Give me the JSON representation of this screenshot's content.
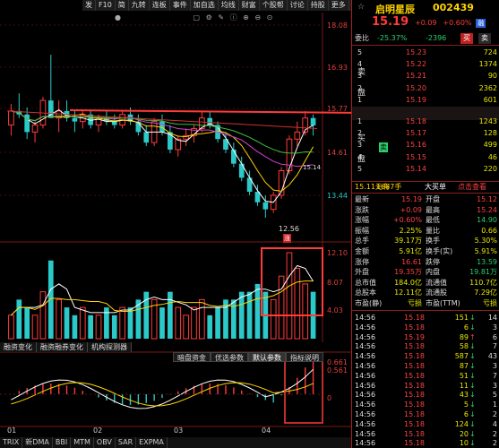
{
  "toolbar": {
    "items": [
      "发",
      "F10",
      "简",
      "九转",
      "连板",
      "事件",
      "加自选",
      "均线",
      "财富",
      "个股帮",
      "讨论",
      "持股",
      "更多"
    ]
  },
  "price_axis": [
    "18.08",
    "16.93",
    "15.77",
    "14.61",
    "13.44",
    "12.10",
    "8.07",
    "4.03"
  ],
  "annotations": {
    "low_price": "12.56",
    "low_tag": "涨",
    "last_marker": "15.14"
  },
  "chart_tabs": [
    "融资变化",
    "融资融券变化",
    "机构探测器"
  ],
  "indicator_tabs": [
    "暗盘资金",
    "优选参数",
    "默认参数",
    "指标说明"
  ],
  "indicator_axis": [
    "0.661",
    "0.561",
    "0"
  ],
  "dates": [
    "01",
    "02",
    "03",
    "04"
  ],
  "bottom_tabs": [
    "TRIX",
    "新DMA",
    "BBI",
    "MTM",
    "OBV",
    "SAR",
    "EXPMA"
  ],
  "quote": {
    "name": "启明星辰",
    "code": "002439",
    "last_price": "15.19",
    "change": "+0.09",
    "change_pct": "+0.60%",
    "badge": "融",
    "ratio_label": "委比",
    "ratio_pct": "-25.37%",
    "ratio_diff": "-2396",
    "buy_btn": "买",
    "sell_btn": "卖",
    "asks": [
      {
        "lvl": "5",
        "price": "15.23",
        "vol": "724"
      },
      {
        "lvl": "4",
        "price": "15.22",
        "vol": "1374"
      },
      {
        "lvl": "3",
        "price": "15.21",
        "vol": "90"
      },
      {
        "lvl": "2",
        "price": "15.20",
        "vol": "2362"
      },
      {
        "lvl": "1",
        "price": "15.19",
        "vol": "601"
      }
    ],
    "bids": [
      {
        "lvl": "1",
        "price": "15.18",
        "vol": "1243"
      },
      {
        "lvl": "2",
        "price": "15.17",
        "vol": "128"
      },
      {
        "lvl": "3",
        "price": "15.16",
        "vol": "499"
      },
      {
        "lvl": "4",
        "price": "15.15",
        "vol": "46"
      },
      {
        "lvl": "5",
        "price": "15.14",
        "vol": "220"
      }
    ],
    "ask_chars": [
      "卖",
      "盘"
    ],
    "bid_chars": [
      "买",
      "盘"
    ],
    "bid_tag": "卖",
    "bidask": {
      "a": "15.11元有",
      "b": "1687手",
      "c": "大买单",
      "d": "点击查看"
    },
    "stats": [
      {
        "k1": "最新",
        "v1": "15.19",
        "c1": "r",
        "k2": "开盘",
        "v2": "15.12",
        "c2": "r"
      },
      {
        "k1": "涨跌",
        "v1": "+0.09",
        "c1": "r",
        "k2": "最高",
        "v2": "15.24",
        "c2": "r"
      },
      {
        "k1": "涨幅",
        "v1": "+0.60%",
        "c1": "r",
        "k2": "最低",
        "v2": "14.90",
        "c2": "g"
      },
      {
        "k1": "振幅",
        "v1": "2.25%",
        "c1": "y",
        "k2": "量比",
        "v2": "0.66",
        "c2": "y"
      },
      {
        "k1": "总手",
        "v1": "39.17万",
        "c1": "y",
        "k2": "换手",
        "v2": "5.30%",
        "c2": "y"
      },
      {
        "k1": "金额",
        "v1": "5.91亿",
        "c1": "y",
        "k2": "换手(实)",
        "v2": "5.91%",
        "c2": "y"
      },
      {
        "k1": "涨停",
        "v1": "16.61",
        "c1": "r",
        "k2": "跌停",
        "v2": "13.59",
        "c2": "g"
      },
      {
        "k1": "外盘",
        "v1": "19.35万",
        "c1": "r",
        "k2": "内盘",
        "v2": "19.81万",
        "c2": "g"
      },
      {
        "k1": "总市值",
        "v1": "184.0亿",
        "c1": "y",
        "k2": "流通值",
        "v2": "110.7亿",
        "c2": "y"
      },
      {
        "k1": "总股本",
        "v1": "12.11亿",
        "c1": "y",
        "k2": "流通股",
        "v2": "7.29亿",
        "c2": "y"
      },
      {
        "k1": "市盈(静)",
        "v1": "亏损",
        "c1": "y",
        "k2": "市盈(TTM)",
        "v2": "亏损",
        "c2": "y"
      }
    ],
    "ticks": [
      {
        "t": "14:56",
        "p": "15.18",
        "v": "151",
        "d": "dn",
        "n": "14"
      },
      {
        "t": "14:56",
        "p": "15.18",
        "v": "6",
        "d": "dn",
        "n": "3"
      },
      {
        "t": "14:56",
        "p": "15.19",
        "v": "89",
        "d": "up",
        "n": "6"
      },
      {
        "t": "14:56",
        "p": "15.18",
        "v": "58",
        "d": "dn",
        "n": "7"
      },
      {
        "t": "14:56",
        "p": "15.18",
        "v": "587",
        "d": "dn",
        "n": "43"
      },
      {
        "t": "14:56",
        "p": "15.18",
        "v": "87",
        "d": "dn",
        "n": "3"
      },
      {
        "t": "14:56",
        "p": "15.18",
        "v": "51",
        "d": "dn",
        "n": "7"
      },
      {
        "t": "14:56",
        "p": "15.18",
        "v": "11",
        "d": "dn",
        "n": "3"
      },
      {
        "t": "14:56",
        "p": "15.18",
        "v": "43",
        "d": "dn",
        "n": "5"
      },
      {
        "t": "14:56",
        "p": "15.18",
        "v": "5",
        "d": "dn",
        "n": "1"
      },
      {
        "t": "14:56",
        "p": "15.18",
        "v": "6",
        "d": "dn",
        "n": "2"
      },
      {
        "t": "14:56",
        "p": "15.18",
        "v": "124",
        "d": "dn",
        "n": "4"
      },
      {
        "t": "14:56",
        "p": "15.18",
        "v": "20",
        "d": "dn",
        "n": "2"
      },
      {
        "t": "14:56",
        "p": "15.18",
        "v": "10",
        "d": "dn",
        "n": "2"
      }
    ]
  },
  "colors": {
    "up": "#ff3b3b",
    "down": "#2bc9c9",
    "highlight_box": "#ff3b3b",
    "name": "#ffd400"
  },
  "candles": [
    [
      15.2,
      15.8,
      14.9,
      15.6
    ],
    [
      15.6,
      16.1,
      15.4,
      15.5
    ],
    [
      15.5,
      15.7,
      14.8,
      15.0
    ],
    [
      15.0,
      15.3,
      14.7,
      15.2
    ],
    [
      15.2,
      16.0,
      15.1,
      15.9
    ],
    [
      15.9,
      17.2,
      15.6,
      15.4
    ],
    [
      15.4,
      15.9,
      15.0,
      15.6
    ],
    [
      15.6,
      15.9,
      15.3,
      15.4
    ],
    [
      15.4,
      15.6,
      15.0,
      15.3
    ],
    [
      15.3,
      15.6,
      15.1,
      15.5
    ],
    [
      15.5,
      15.6,
      15.1,
      15.2
    ],
    [
      15.2,
      15.5,
      15.0,
      15.4
    ],
    [
      15.4,
      15.6,
      15.2,
      15.3
    ],
    [
      15.3,
      15.5,
      15.1,
      15.2
    ],
    [
      15.2,
      15.6,
      15.1,
      15.5
    ],
    [
      15.5,
      15.7,
      15.2,
      15.3
    ],
    [
      15.3,
      15.5,
      14.9,
      15.0
    ],
    [
      15.0,
      15.2,
      14.6,
      14.7
    ],
    [
      14.7,
      15.4,
      14.6,
      15.3
    ],
    [
      15.3,
      15.5,
      14.9,
      15.0
    ],
    [
      15.0,
      15.2,
      14.4,
      14.5
    ],
    [
      14.5,
      14.9,
      14.3,
      14.8
    ],
    [
      14.8,
      15.1,
      14.6,
      14.9
    ],
    [
      14.9,
      15.2,
      14.7,
      15.1
    ],
    [
      15.1,
      15.6,
      15.0,
      15.4
    ],
    [
      15.4,
      15.6,
      15.1,
      15.2
    ],
    [
      15.2,
      15.3,
      14.7,
      14.8
    ],
    [
      14.8,
      15.0,
      14.4,
      14.5
    ],
    [
      14.5,
      14.7,
      14.0,
      14.1
    ],
    [
      14.1,
      14.3,
      13.6,
      13.7
    ],
    [
      13.7,
      13.9,
      13.2,
      13.3
    ],
    [
      13.3,
      13.5,
      12.9,
      13.0
    ],
    [
      13.0,
      13.2,
      12.56,
      12.8
    ],
    [
      12.8,
      13.3,
      12.7,
      13.2
    ],
    [
      13.2,
      14.0,
      13.1,
      13.9
    ],
    [
      13.9,
      14.9,
      13.8,
      14.8
    ],
    [
      14.8,
      15.3,
      14.6,
      15.0
    ],
    [
      15.0,
      15.6,
      14.9,
      15.4
    ],
    [
      15.4,
      15.5,
      14.9,
      15.19
    ]
  ]
}
